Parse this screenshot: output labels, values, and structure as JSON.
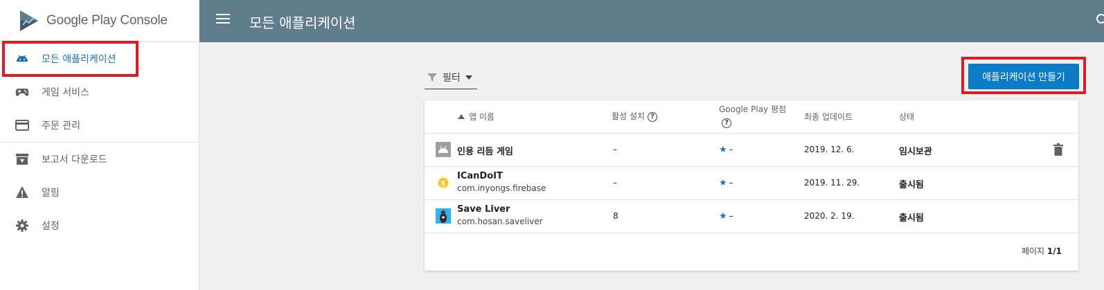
{
  "sidebar": {
    "logo": {
      "brand": "Google Play",
      "product": "Console"
    },
    "items": [
      {
        "label": "모든 애플리케이션",
        "icon": "android-icon",
        "active": true
      },
      {
        "label": "게임 서비스",
        "icon": "gamepad-icon"
      },
      {
        "label": "주문 관리",
        "icon": "credit-card-icon"
      },
      {
        "label": "보고서 다운로드",
        "icon": "archive-download-icon"
      },
      {
        "label": "알림",
        "icon": "warning-icon"
      },
      {
        "label": "설정",
        "icon": "gear-icon"
      }
    ]
  },
  "header": {
    "title": "모든 애플리케이션"
  },
  "toolbar": {
    "filter_label": "필터",
    "create_label": "애플리케이션 만들기"
  },
  "table": {
    "columns": {
      "name": "앱 이름",
      "installs": "활성 설치",
      "rating": "Google Play 평점",
      "updated": "최종 업데이트",
      "status": "상태"
    },
    "rows": [
      {
        "name": "인용 리듬 게임",
        "package": "",
        "installs": "–",
        "rating": "–",
        "updated": "2019. 12. 6.",
        "status": "임시보관"
      },
      {
        "name": "ICanDoIT",
        "package": "com.inyongs.firebase",
        "installs": "–",
        "rating": "–",
        "updated": "2019. 11. 29.",
        "status": "출시됨"
      },
      {
        "name": "Save Liver",
        "package": "com.hosan.saveliver",
        "installs": "8",
        "rating": "–",
        "updated": "2020. 2. 19.",
        "status": "출시됨"
      }
    ],
    "pager": {
      "label": "페이지",
      "value": "1/1"
    }
  },
  "colors": {
    "topbar": "#607d8b",
    "accent": "#0a7bc4",
    "highlight": "#e01b22"
  }
}
